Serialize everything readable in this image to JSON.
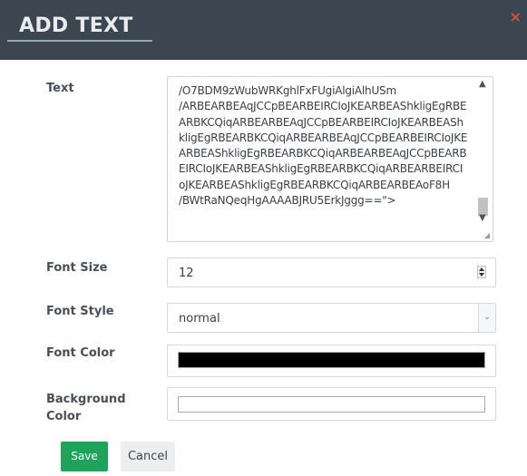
{
  "dialog": {
    "title": "ADD TEXT",
    "close_icon": "close-icon",
    "accent": "#e24a3b",
    "header_bg": "#3b4650"
  },
  "fields": {
    "text_label": "Text",
    "text_value": "/O7BDM9zWubWRKghlFxFUgiAlgiAlhUSm\n/ARBEARBEAqJCCpBEARBEIRCIoJKEARBEAShkligEgRBEARBKCQiqARBEARBEAqJCCpBEARBEIRCIoJKEARBEAShkligEgRBEARBKCQiqARBEARBEAqJCCpBEARBEIRCIoJKEARBEAShkligEgRBEARBKCQiqARBEARBEAqJCCpBEARBEIRCIoJKEARBEAShkligEgRBEARBKCQiqARBEARBEIRCIoJKEARBEAShkligEgRBEARBKCQiqARBEARBEAoF8H\n/BWtRaNQeqHgAAAABJRU5ErkJggg==\">",
    "font_size_label": "Font Size",
    "font_size_value": "12",
    "font_style_label": "Font Style",
    "font_style_value": "normal",
    "font_color_label": "Font Color",
    "font_color_value": "#000000",
    "background_color_label_line1": "Background",
    "background_color_label_line2": "Color",
    "background_color_value": "#ffffff"
  },
  "actions": {
    "save_label": "Save",
    "cancel_label": "Cancel",
    "save_color": "#1fa25a"
  }
}
